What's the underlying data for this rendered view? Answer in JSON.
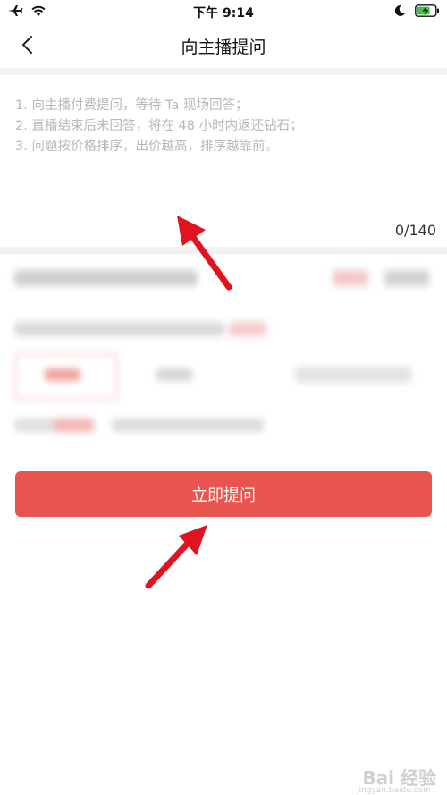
{
  "status_bar": {
    "time": "下午 9:14",
    "left_icons": [
      "airplane-icon",
      "wifi-icon"
    ],
    "right_icons": [
      "moon-icon",
      "battery-charging-icon"
    ]
  },
  "nav": {
    "title": "向主播提问",
    "back_icon": "chevron-left-icon"
  },
  "question_input": {
    "hints": [
      "1. 向主播付费提问，等待 Ta 现场回答；",
      "2. 直播结束后未回答，将在 48 小时内返还钻石；",
      "3. 问题按价格排序，出价越高，排序越靠前。"
    ],
    "char_count": "0/140"
  },
  "submit_button": {
    "label": "立即提问",
    "color": "#e8554e"
  },
  "annotations": {
    "arrow_color": "#e0141e"
  },
  "watermark": {
    "text": "Bai 经验",
    "sub": "jingyan.baidu.com"
  }
}
